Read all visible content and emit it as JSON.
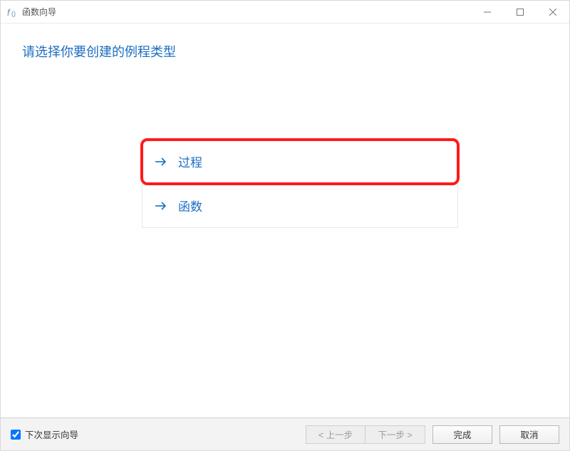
{
  "titlebar": {
    "app_title": "函数向导"
  },
  "content": {
    "heading": "请选择你要创建的例程类型",
    "options": [
      {
        "label": "过程",
        "highlight": true
      },
      {
        "label": "函数",
        "highlight": false
      }
    ]
  },
  "footer": {
    "checkbox_label": "下次显示向导",
    "checkbox_checked": true,
    "buttons": {
      "back": "< 上一步",
      "next": "下一步 >",
      "finish": "完成",
      "cancel": "取消"
    }
  }
}
